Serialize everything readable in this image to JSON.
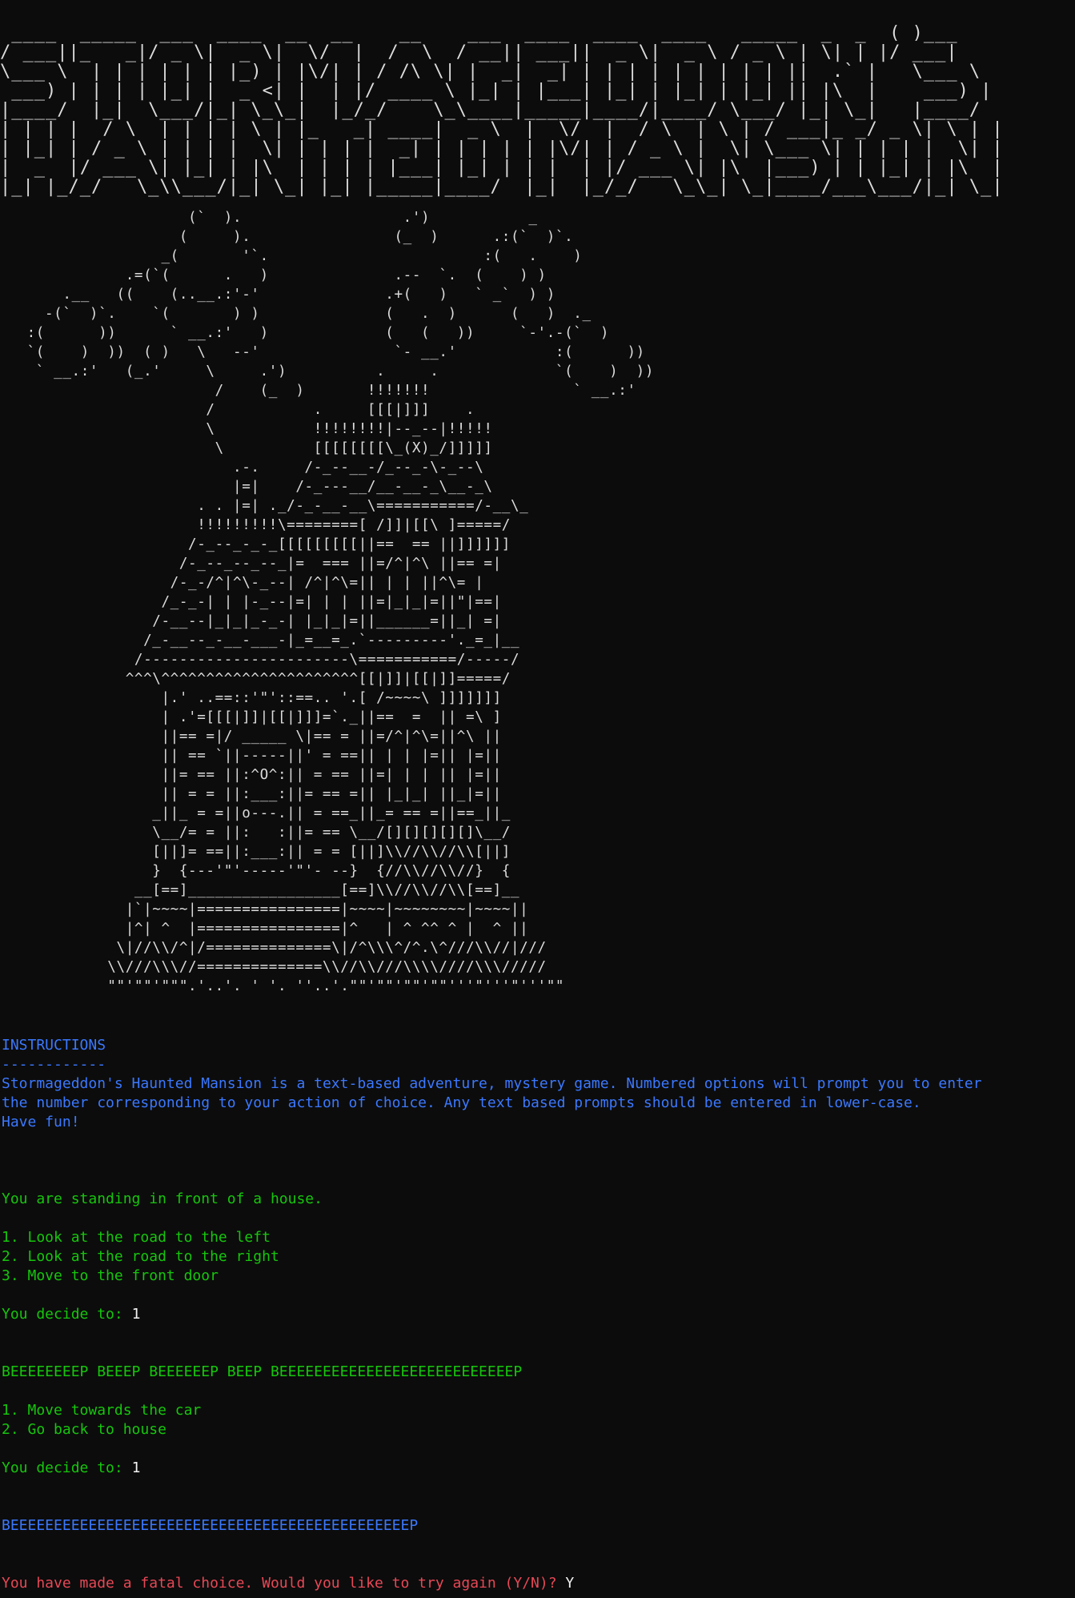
{
  "title_art": " ____  _____  ___  ____  __  __    __    ___  ____  ____  ____   _____  _  _  ( )___\n/ ___||_   _|/ _ \\|  _ \\|  \\/  |  /  \\  / __|| ___||  _ \\|  _ \\ / _ \\ | \\| | |/ ___|\n\\___ \\  | | | | | | |_) | |\\/| | / /\\ \\| |  _|  _| | | | | | | | | | ||  .` |   \\___ \\\n ___) | | | | |_| |  _ <| |  | |/ ____ \\ |_| | |___| |_| | |_| | |_| || |\\  |    ___) |\n|____/  |_|  \\___/|_| \\_\\_|  |_/_/    \\_\\____|_____|____/|____/ \\___/ |_| \\_|   |____/\n| | | |  / \\  | | | | \\ | |_   _| ____|  _ \\  |  \\/  |  / \\  | \\ | / ___|_ _/ _ \\| \\ | |\n| |_| | / _ \\ | | | |  \\| | | | |  _| | | | | | |\\/| | / _ \\ |  \\| \\___ \\| | | | |  \\| |\n|  _  |/ ___ \\| |_| | |\\  | | | | |___| |_| | | |  | |/ ___ \\| |\\  |___) | | |_| | |\\  |\n|_| |_/_/   \\_\\\\___/|_| \\_| |_| |_____|____/  |_|  |_/_/   \\_\\_| \\_|____/___\\___/|_| \\_|",
  "mansion_art": "                     (`  ).                  .')           _\n                    (     ).                (_  )      .:(`  )`.\n                  _(       '`.                        :(   .    )\n              .=(`(      .   )              .--  `.  (    ) )\n       .__   ((    (..__.:'-'              .+(   )   ` _`  ) )\n     -(`  )`.    `(       ) )              (   .  )      (   )  ._\n   :(      ))      ` __.:'   )             (   (   ))     `-'.-(`  )\n   `(    )  ))  ( )   \\   --'               `- __.'           :(      ))\n    ` __.:'   (_.'     \\     .')          .     .             `(    )  ))\n                        /    (_  )       !!!!!!!                ` __.:'\n                       /           .     [[[|]]]    .\n                       \\           !!!!!!!!|--_--|!!!!!\n                        \\          [[[[[[[[\\_(X)_/]]]]]\n                          .-.     /-_--__-/_--_-\\-_--\\\n                          |=|    /-_---__/__-__-_\\__-_\\\n                      . . |=| ._/-_-__-__\\===========/-__\\_\n                      !!!!!!!!!\\========[ /]]|[[\\ ]=====/\n                     /-_--_-_-_[[[[[[[[[||==  == ||]]]]]]\n                    /-_--_--_--_|=  === ||=/^|^\\ ||== =|\n                   /-_-/^|^\\-_--| /^|^\\=|| | | ||^\\= |\n                  /_-_-| | |-_--|=| | | ||=|_|_|=||\"|==|\n                 /-__--|_|_|_-_-| |_|_|=||______=||_| =|\n                /_-__--_-__-___-|_=__=_.`---------'._=_|__\n               /-----------------------\\===========/-----/\n              ^^^\\^^^^^^^^^^^^^^^^^^^^^^[[|]]|[[|]]=====/\n                  |.' ..==::'\"'::==.. '.[ /~~~~\\ ]]]]]]]\n                  | .'=[[[|]]|[[|]]]=`._||==  =  || =\\ ]\n                  ||== =|/ _____ \\|== = ||=/^|^\\=||^\\ ||\n                  || == `||-----||' = ==|| | | |=|| |=||\n                  ||= == ||:^O^:|| = == ||=| | | || |=||\n                  || = = ||:___:||= == =|| |_|_| ||_|=||\n                 _||_ = =||o---.|| = ==_||_= == =||==_||_\n                 \\__/= = ||:   :||= == \\__/[][][][][]\\__/\n                 [||]= ==||:___:|| = = [||]\\\\//\\\\//\\\\[||]\n                 }  {---'\"'-----'\"'- --}  {//\\\\//\\\\//}  {\n               __[==]_________________[==]\\\\//\\\\//\\\\[==]__\n              |`|~~~~|================|~~~~|~~~~~~~~|~~~~||\n              |^| ^  |================|^   | ^ ^^ ^ |  ^ ||\n             \\|//\\\\/^|/==============\\|/^\\\\\\^/^.\\^///\\\\//|///\n            \\\\///\\\\\\//==============\\\\//\\\\///\\\\\\\\////\\\\\\/////\n            \"\"'\"\"'\"\"\".'..'. ' '. ''..'.\"\"'\"\"'\"\"'\"\"'''\"'''\"'''\"\"",
  "instructions": {
    "heading": "INSTRUCTIONS",
    "underline": "------------",
    "body_line1": "Stormageddon's Haunted Mansion is a text-based adventure, mystery game. Numbered options will prompt you to enter",
    "body_line2": "the number corresponding to your action of choice. Any text based prompts should be entered in lower-case.",
    "body_line3": "Have fun!"
  },
  "scene1": {
    "narration": "You are standing in front of a house.",
    "options": [
      "1. Look at the road to the left",
      "2. Look at the road to the right",
      "3. Move to the front door"
    ],
    "prompt": "You decide to: ",
    "input": "1"
  },
  "scene2": {
    "narration": "BEEEEEEEEP BEEEP BEEEEEEP BEEP BEEEEEEEEEEEEEEEEEEEEEEEEEEEP",
    "options": [
      "1. Move towards the car",
      "2. Go back to house"
    ],
    "prompt": "You decide to: ",
    "input": "1"
  },
  "scene3": {
    "narration": "BEEEEEEEEEEEEEEEEEEEEEEEEEEEEEEEEEEEEEEEEEEEEEEP"
  },
  "fatal": {
    "prompt": "You have made a fatal choice. Would you like to try again (Y/N)? ",
    "input": "Y"
  },
  "colors": {
    "background": "#0c0c0c",
    "art": "#dcdcdc",
    "blue": "#3b78ff",
    "green": "#16c60c",
    "red": "#e74856",
    "input": "#f2f2f2"
  }
}
